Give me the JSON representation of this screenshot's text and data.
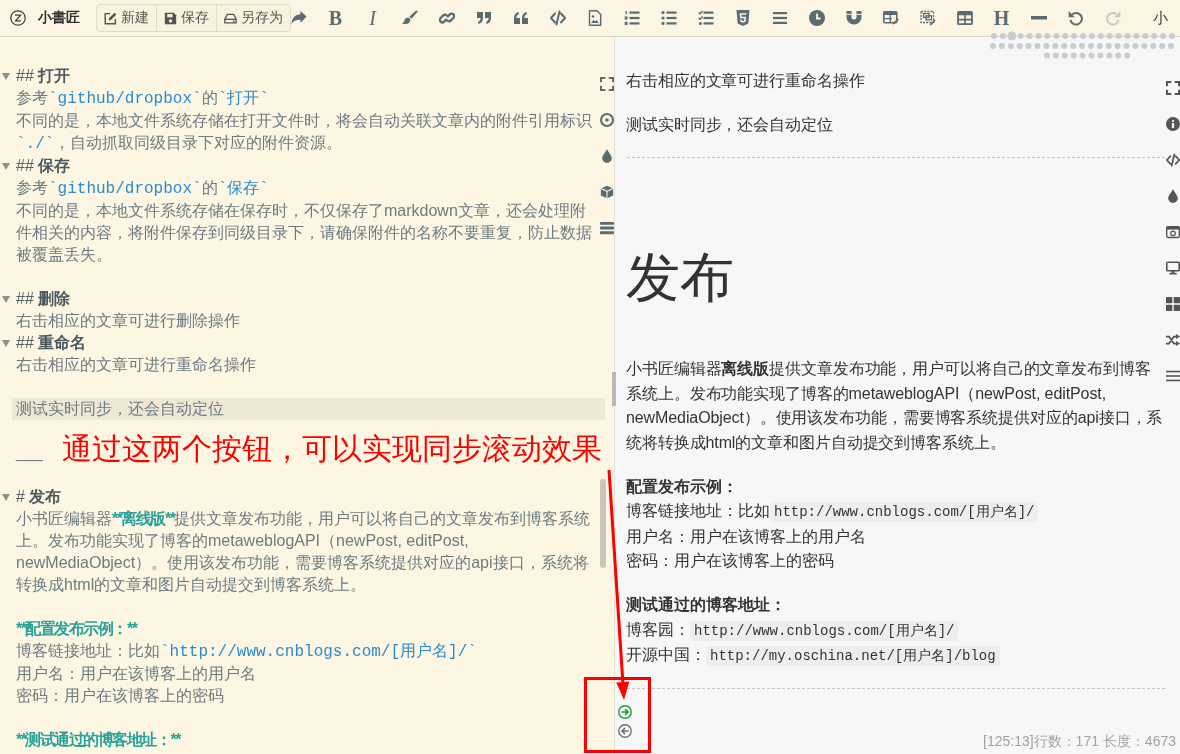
{
  "toolbar": {
    "app_name": "小書匠",
    "file_buttons": [
      {
        "label": "新建",
        "kind": "edit"
      },
      {
        "label": "保存",
        "kind": "save"
      },
      {
        "label": "另存为",
        "kind": "drive"
      }
    ],
    "tools": [
      {
        "kind": "forward",
        "disabled": false
      },
      {
        "kind": "bold",
        "text": "B",
        "disabled": false
      },
      {
        "kind": "italic",
        "text": "I",
        "disabled": false
      },
      {
        "kind": "brush",
        "disabled": false
      },
      {
        "kind": "link",
        "disabled": false
      },
      {
        "kind": "quoteright",
        "disabled": false
      },
      {
        "kind": "quoteleft",
        "disabled": false
      },
      {
        "kind": "code",
        "disabled": false
      },
      {
        "kind": "image",
        "disabled": false
      },
      {
        "kind": "olist",
        "disabled": false
      },
      {
        "kind": "ulist",
        "disabled": false
      },
      {
        "kind": "tasks",
        "disabled": false
      },
      {
        "kind": "html",
        "disabled": false
      },
      {
        "kind": "justify",
        "disabled": false
      },
      {
        "kind": "clock",
        "disabled": false
      },
      {
        "kind": "magnet",
        "disabled": false
      },
      {
        "kind": "tableedit",
        "disabled": false
      },
      {
        "kind": "imageedit",
        "disabled": false
      },
      {
        "kind": "table",
        "disabled": false
      },
      {
        "kind": "heading",
        "text": "H",
        "disabled": false
      },
      {
        "kind": "rule",
        "disabled": false
      },
      {
        "kind": "undo",
        "disabled": false
      },
      {
        "kind": "redo",
        "disabled": true
      }
    ],
    "menu_label": "小"
  },
  "editor": {
    "blocks": [
      {
        "lines": [
          {
            "kind": "heading",
            "text": "## **打开**",
            "active": false
          },
          {
            "kind": "text",
            "segments": [
              {
                "kind": "plain",
                "text": "参考"
              },
              {
                "kind": "code",
                "text": "`github/dropbox`"
              },
              {
                "kind": "plain",
                "text": "的"
              },
              {
                "kind": "code",
                "text": "`打开`"
              }
            ],
            "active": false
          },
          {
            "kind": "text",
            "segments": [
              {
                "kind": "plain",
                "text": "不同的是，本地文件系统存储在打开文件时，将会自动关联文章内的附件引用标识"
              },
              {
                "kind": "code",
                "text": "`./`"
              },
              {
                "kind": "plain",
                "text": "，自动抓取同级目录下对应的附件资源。"
              }
            ],
            "active": false
          },
          {
            "kind": "heading",
            "text": "## **保存**",
            "active": false
          },
          {
            "kind": "text",
            "segments": [
              {
                "kind": "plain",
                "text": "参考"
              },
              {
                "kind": "code",
                "text": "`github/dropbox`"
              },
              {
                "kind": "plain",
                "text": "的"
              },
              {
                "kind": "code",
                "text": "`保存`"
              }
            ],
            "active": false
          },
          {
            "kind": "text",
            "segments": [
              {
                "kind": "plain",
                "text": "不同的是，本地文件系统存储在保存时，不仅保存了markdown文章，还会处理附件相关的内容，将附件保存到同级目录下，请确保附件的名称不要重复，防止数据被覆盖丢失。"
              }
            ],
            "active": false
          }
        ]
      },
      {
        "lines": [
          {
            "kind": "heading",
            "text": "## **删除**",
            "active": false
          },
          {
            "kind": "text",
            "segments": [
              {
                "kind": "plain",
                "text": "右击相应的文章可进行删除操作"
              }
            ],
            "active": false
          },
          {
            "kind": "heading",
            "text": "## **重命名**",
            "active": false
          },
          {
            "kind": "text",
            "segments": [
              {
                "kind": "plain",
                "text": "右击相应的文章可进行重命名操作"
              }
            ],
            "active": false
          }
        ]
      },
      {
        "lines": [
          {
            "kind": "text",
            "segments": [
              {
                "kind": "plain",
                "text": "测试实时同步，还会自动定位"
              }
            ],
            "active": true
          }
        ]
      },
      {
        "lines": [
          {
            "kind": "text",
            "segments": [
              {
                "kind": "plain",
                "text": "___"
              }
            ],
            "active": false
          }
        ]
      },
      {
        "lines": [
          {
            "kind": "heading",
            "text": "# **发布**",
            "active": false
          },
          {
            "kind": "text",
            "segments": [
              {
                "kind": "plain",
                "text": "小书匠编辑器"
              },
              {
                "kind": "strong",
                "text": "**离线版**"
              },
              {
                "kind": "plain",
                "text": "提供文章发布功能，用户可以将自己的文章发布到博客系统上。发布功能实现了博客的metaweblogAPI（newPost, editPost, newMediaObject）。使用该发布功能，需要博客系统提供对应的api接口，系统将转换成html的文章和图片自动提交到博客系统上。"
              }
            ],
            "active": false
          }
        ]
      },
      {
        "lines": [
          {
            "kind": "text",
            "segments": [
              {
                "kind": "strong",
                "text": "**配置发布示例：**"
              }
            ],
            "active": false
          },
          {
            "kind": "text",
            "segments": [
              {
                "kind": "plain",
                "text": "博客链接地址：比如"
              },
              {
                "kind": "code",
                "text": "`http://www.cnblogs.com/[用户名]/`"
              }
            ],
            "active": false
          },
          {
            "kind": "text",
            "segments": [
              {
                "kind": "plain",
                "text": "用户名：用户在该博客上的用户名"
              }
            ],
            "active": false
          },
          {
            "kind": "text",
            "segments": [
              {
                "kind": "plain",
                "text": "密码：用户在该博客上的密码"
              }
            ],
            "active": false
          }
        ]
      },
      {
        "lines": [
          {
            "kind": "text",
            "segments": [
              {
                "kind": "strong",
                "text": "**测试通过的博客地址：**"
              }
            ],
            "active": false
          }
        ]
      }
    ]
  },
  "preview": {
    "blocks": [
      {
        "kind": "paragraph",
        "text": "右击相应的文章可进行重命名操作"
      },
      {
        "kind": "paragraph",
        "text": "测试实时同步，还会自动定位"
      },
      {
        "kind": "rule"
      },
      {
        "kind": "heading",
        "text": "发布"
      },
      {
        "kind": "paragraph",
        "text": "小书匠编辑器**离线版**提供文章发布功能，用户可以将自己的文章发布到博客系统上。发布功能实现了博客的metaweblogAPI（newPost, editPost, newMediaObject）。使用该发布功能，需要博客系统提供对应的api接口，系统将转换成html的文章和图片自动提交到博客系统上。"
      },
      {
        "kind": "lines",
        "lines": [
          {
            "kind": "strong",
            "text": "配置发布示例："
          },
          {
            "kind": "text",
            "text": "博客链接地址：比如",
            "code": "http://www.cnblogs.com/[用户名]/"
          },
          {
            "kind": "text",
            "text": "用户名：用户在该博客上的用户名"
          },
          {
            "kind": "text",
            "text": "密码：用户在该博客上的密码"
          }
        ]
      },
      {
        "kind": "lines",
        "lines": [
          {
            "kind": "strong",
            "text": "测试通过的博客地址："
          },
          {
            "kind": "text",
            "text": "博客园：",
            "code": "http://www.cnblogs.com/[用户名]/"
          },
          {
            "kind": "text",
            "text": "开源中国：",
            "code": "http://my.oschina.net/[用户名]/blog"
          }
        ]
      },
      {
        "kind": "rule"
      }
    ]
  },
  "sync_buttons": [
    {
      "kind": "right",
      "on": true
    },
    {
      "kind": "left",
      "on": false
    }
  ],
  "status": "[125:13]行数：171 长度：4673",
  "annotation": {
    "text": "通过这两个按钮，可以实现同步滚动效果"
  }
}
